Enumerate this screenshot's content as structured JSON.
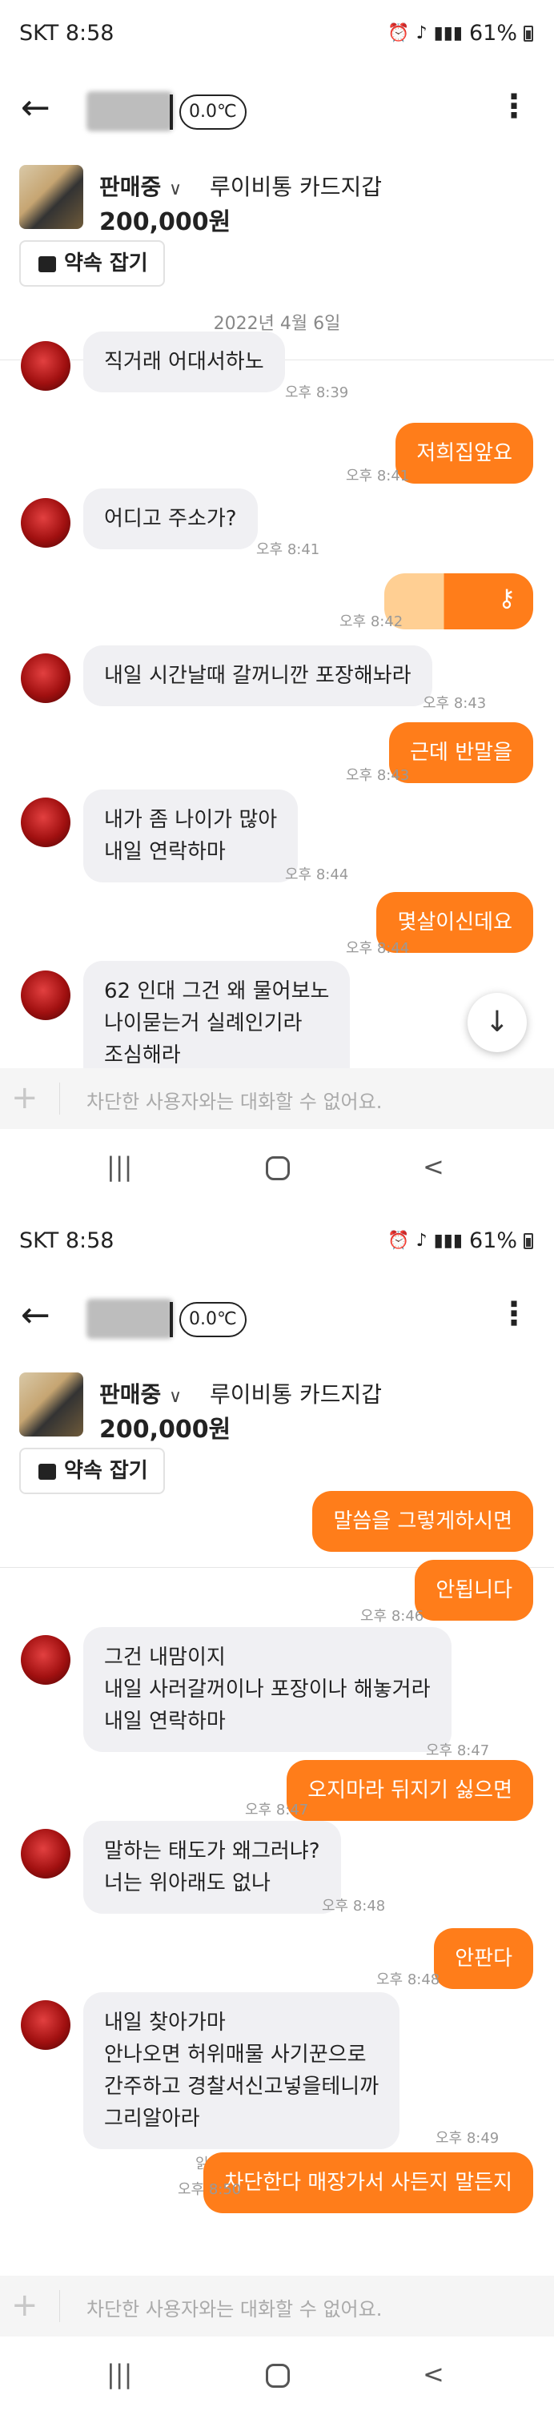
{
  "colors": {
    "accent": "#ff7d1a",
    "bubble_in": "#f0f0f3"
  },
  "screens": [
    {
      "status": {
        "carrier": "SKT 8:58",
        "battery": "61%"
      },
      "header": {
        "temperature": "0.0℃"
      },
      "product": {
        "status": "판매중",
        "chevron": "∨",
        "name": "루이비통 카드지갑",
        "price": "200,000원",
        "promise_button": "약속 잡기"
      },
      "date": "2022년 4월 6일",
      "messages": [
        {
          "from": "other",
          "text": "직거래 어대서하노",
          "time": "오후 8:39"
        },
        {
          "from": "me",
          "text": "저희집앞요",
          "time": "오후 8:41"
        },
        {
          "from": "other",
          "text": "어디고 주소가?",
          "time": "오후 8:41"
        },
        {
          "from": "me",
          "type": "image",
          "time": "오후 8:42"
        },
        {
          "from": "other",
          "text": "내일 시간날때 갈꺼니깐 포장해놔라",
          "time": "오후 8:43"
        },
        {
          "from": "me",
          "text": "근데 반말을",
          "time": "오후 8:43"
        },
        {
          "from": "other",
          "text": "내가 좀 나이가 많아\n내일 연락하마",
          "time": "오후 8:44"
        },
        {
          "from": "me",
          "text": "몇살이신데요",
          "time": "오후 8:44"
        },
        {
          "from": "other",
          "text": "62 인대 그건 왜 물어보노\n나이묻는거 실례인기라\n조심해라",
          "time": ""
        }
      ],
      "input_placeholder": "차단한 사용자와는 대화할 수 없어요.",
      "nav": {
        "recent": "|||",
        "back": "<"
      }
    },
    {
      "status": {
        "carrier": "SKT 8:58",
        "battery": "61%"
      },
      "header": {
        "temperature": "0.0℃"
      },
      "product": {
        "status": "판매중",
        "chevron": "∨",
        "name": "루이비통 카드지갑",
        "price": "200,000원",
        "promise_button": "약속 잡기"
      },
      "messages": [
        {
          "from": "me",
          "text": "말씀을 그렇게하시면",
          "time": ""
        },
        {
          "from": "me",
          "text": "안됩니다",
          "time": "오후 8:46"
        },
        {
          "from": "other",
          "text": "그건 내맘이지\n 내일 사러갈꺼이나 포장이나 해놓거라\n내일 연락하마",
          "time": "오후 8:47"
        },
        {
          "from": "me",
          "text": "오지마라 뒤지기 싫으면",
          "time": "오후 8:47"
        },
        {
          "from": "other",
          "text": "말하는 태도가 왜그러냐?\n너는 위아래도 없나",
          "time": "오후 8:48"
        },
        {
          "from": "me",
          "text": "안판다",
          "time": "오후 8:48"
        },
        {
          "from": "other",
          "text": "내일 찾아가마\n안나오면 허위매물 사기꾼으로\n간주하고 경찰서신고넣을테니까\n그리알아라",
          "time": "오후 8:49"
        },
        {
          "from": "me",
          "text": "차단한다 매장가서 사든지 말든지",
          "time": "오후 8:50",
          "read": "읽음"
        }
      ],
      "input_placeholder": "차단한 사용자와는 대화할 수 없어요.",
      "nav": {
        "recent": "|||",
        "back": "<"
      }
    }
  ]
}
